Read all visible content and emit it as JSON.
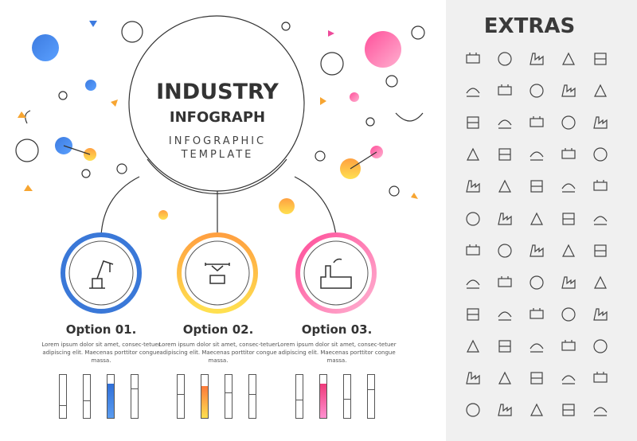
{
  "header": {
    "title_line1": "INDUSTRY",
    "title_line2": "INFOGRAPH",
    "subtitle_line1": "INFOGRAPHIC",
    "subtitle_line2": "TEMPLATE"
  },
  "options": [
    {
      "title": "Option 01.",
      "text": "Lorem ipsum dolor sit amet, consec-tetuer adipiscing elit. Maecenas porttitor congue massa.",
      "icon": "crane-icon",
      "color": "#3a78d8",
      "bars": [
        0.27,
        0.38,
        0.8,
        0.67
      ],
      "highlight": 2
    },
    {
      "title": "Option 02.",
      "text": "Lorem ipsum dolor sit amet, consec-tetuer adipiscing elit. Maecenas porttitor congue massa.",
      "icon": "drone-delivery-icon",
      "color": "#f7a531",
      "bars": [
        0.53,
        0.74,
        0.57,
        0.53
      ],
      "highlight": 1
    },
    {
      "title": "Option 03.",
      "text": "Lorem ipsum dolor sit amet, consec-tetuer adipiscing elit. Maecenas porttitor congue massa.",
      "icon": "factory-icon",
      "color": "#ee4a9a",
      "bars": [
        0.4,
        0.8,
        0.43,
        0.64
      ],
      "highlight": 1
    }
  ],
  "extras": {
    "title": "EXTRAS",
    "icon_count": 60
  }
}
